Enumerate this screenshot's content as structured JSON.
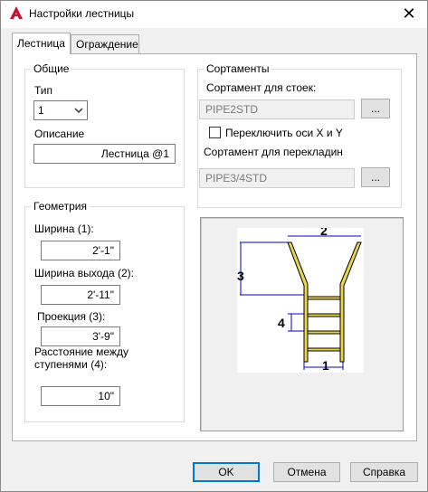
{
  "window": {
    "title": "Настройки лестницы"
  },
  "tabs": [
    {
      "label": "Лестница",
      "active": true
    },
    {
      "label": "Ограждение",
      "active": false
    }
  ],
  "general": {
    "legend": "Общие",
    "type_label": "Тип",
    "type_value": "1",
    "description_label": "Описание",
    "description_value": "Лестница @1"
  },
  "geometry": {
    "legend": "Геометрия",
    "width_label": "Ширина (1):",
    "width_value": "2'-1\"",
    "exit_width_label": "Ширина выхода (2):",
    "exit_width_value": "2'-11\"",
    "projection_label": "Проекция (3):",
    "projection_value": "3'-9\"",
    "step_spacing_label": "Расстояние между ступенями (4):",
    "step_spacing_value": "10\""
  },
  "profiles": {
    "legend": "Сортаменты",
    "post_label": "Сортамент для стоек:",
    "post_value": "PIPE2STD",
    "browse_label": "...",
    "swap_xy_label": "Переключить оси X и Y",
    "swap_xy_checked": false,
    "rung_label": "Сортамент для перекладин",
    "rung_value": "PIPE3/4STD"
  },
  "diagram": {
    "labels": [
      "1",
      "2",
      "3",
      "4"
    ],
    "ladder_color": "#e8d44d",
    "dimension_color": "#0000cc"
  },
  "buttons": {
    "ok": "OK",
    "cancel": "Отмена",
    "help": "Справка"
  }
}
